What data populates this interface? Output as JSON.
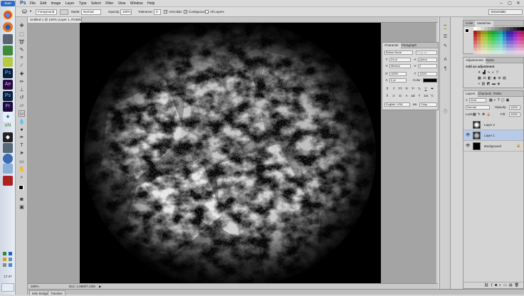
{
  "taskbar": {
    "start_label": "Start",
    "clock": "17:47",
    "icons": [
      "chrome-icon",
      "firefox-icon",
      "steam-icon",
      "media-icon",
      "folder-icon",
      "ps-app-icon",
      "ae-app-icon",
      "ps-app-icon",
      "pr-app-icon",
      "maya-icon",
      "xn-icon",
      "unity-icon",
      "calculator-icon",
      "device-icon",
      "skype-icon",
      "editor-icon",
      "filezilla-icon",
      "shutdown-icon"
    ],
    "xn_label": "xN"
  },
  "menubar": {
    "app_logo": "Ps",
    "items": [
      "File",
      "Edit",
      "Image",
      "Layer",
      "Type",
      "Select",
      "Filter",
      "View",
      "Window",
      "Help"
    ]
  },
  "options_bar": {
    "sample_value": "Foreground",
    "mode_label": "Mode:",
    "mode_value": "Normal",
    "opacity_label": "Opacity:",
    "opacity_value": "100%",
    "tolerance_label": "Tolerance:",
    "tolerance_value": "0",
    "antialias_label": "Anti-alias",
    "antialias_checked": true,
    "contiguous_label": "Contiguous",
    "contiguous_checked": true,
    "all_layers_label": "All Layers",
    "all_layers_checked": false,
    "workspace_value": "Essentials"
  },
  "document": {
    "tab_title": "Untitled-1 @ 100% (Layer 1, RGB/8) *",
    "zoom": "100%",
    "doc_size": "Doc: 1.86M/7.43M"
  },
  "bottom_tabs": [
    "Mini Bridge",
    "Timeline"
  ],
  "character_panel": {
    "tabs": [
      "Character",
      "Paragraph"
    ],
    "font_family": "Bebas Neue",
    "font_style": "Regular",
    "font_size": "24 pt",
    "leading": "(Auto)",
    "kerning": "Metrics",
    "tracking": "0",
    "vertical_scale": "100%",
    "horizontal_scale": "100%",
    "baseline_shift": "0 pt",
    "color_label": "Color:",
    "style_buttons": [
      "T",
      "T",
      "TT",
      "Tr",
      "T¹",
      "T₁",
      "T",
      "T"
    ],
    "opentype_buttons": [
      "fi",
      "ơ",
      "st",
      "A",
      "ad",
      "T",
      "1st",
      "½"
    ],
    "language": "English: USA",
    "aa_label": "aa",
    "antialias": "Crisp"
  },
  "color_panel": {
    "tabs": [
      "Color",
      "Swatches"
    ]
  },
  "adjustments_panel": {
    "tabs": [
      "Adjustments",
      "Styles"
    ],
    "heading": "Add an adjustment"
  },
  "layers_panel": {
    "tabs": [
      "Layers",
      "Channels",
      "Paths"
    ],
    "kind_label": "Kind",
    "blend_mode": "Normal",
    "opacity_label": "Opacity:",
    "opacity_value": "100%",
    "lock_label": "Lock:",
    "fill_label": "Fill:",
    "fill_value": "100%",
    "layers": [
      {
        "name": "Layer 2",
        "visible": false,
        "selected": false
      },
      {
        "name": "Layer 1",
        "visible": true,
        "selected": true
      },
      {
        "name": "Background",
        "visible": true,
        "selected": false
      }
    ]
  },
  "colors": {
    "selection": "#b7cbe8",
    "panel_bg": "#d4d4d4",
    "canvas_bg": "#000000"
  }
}
